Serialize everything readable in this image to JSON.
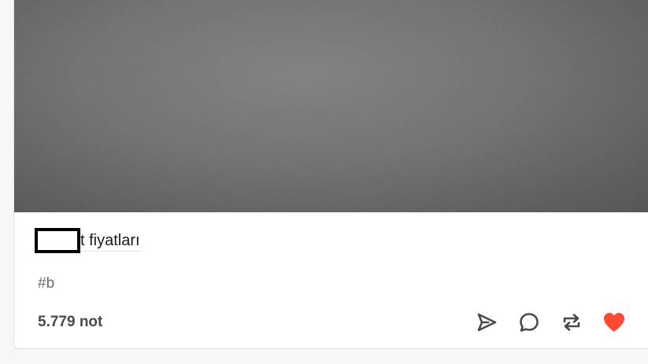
{
  "post": {
    "title_suffix": "t fiyatları",
    "tag": "#b",
    "notes_count": "5.779 not"
  },
  "actions": {
    "share_icon": "send-icon",
    "reply_icon": "comment-icon",
    "reblog_icon": "reblog-icon",
    "like_icon": "heart-icon"
  },
  "colors": {
    "like_active": "#ff4930",
    "icon": "#4a4a4a"
  }
}
